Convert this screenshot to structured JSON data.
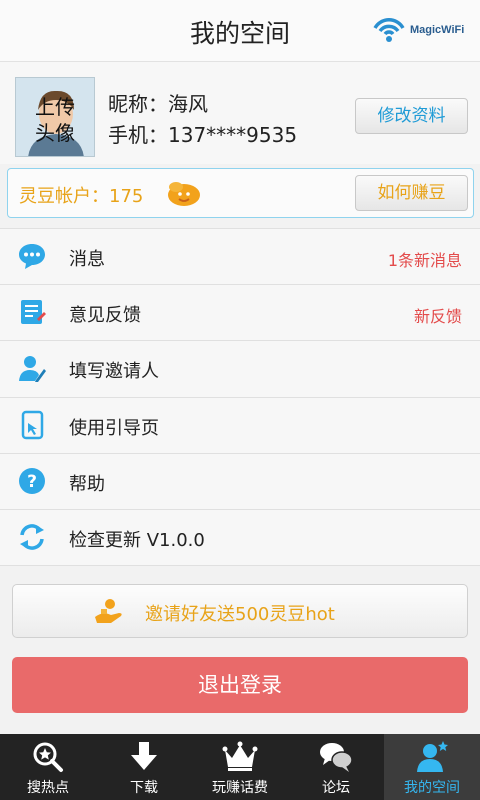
{
  "header": {
    "title": "我的空间",
    "brand_text": "MagicWiFi"
  },
  "profile": {
    "avatar_text_line1": "上传",
    "avatar_text_line2": "头像",
    "nickname": "昵称：海风",
    "phone": "手机：137****9535",
    "edit_button": "修改资料"
  },
  "beans": {
    "label": "灵豆帐户：175",
    "earn_button": "如何赚豆"
  },
  "menu": [
    {
      "icon": "message-bubble-icon",
      "label": "消息",
      "status": "1条新消息"
    },
    {
      "icon": "feedback-note-icon",
      "label": "意见反馈",
      "status": "新反馈"
    },
    {
      "icon": "inviter-person-icon",
      "label": "填写邀请人",
      "status": ""
    },
    {
      "icon": "guide-page-icon",
      "label": "使用引导页",
      "status": ""
    },
    {
      "icon": "help-question-icon",
      "label": "帮助",
      "status": ""
    },
    {
      "icon": "refresh-update-icon",
      "label": "检查更新 V1.0.0",
      "status": ""
    }
  ],
  "invite": {
    "label": "邀请好友送500灵豆hot"
  },
  "logout": {
    "label": "退出登录"
  },
  "tabs": [
    {
      "icon": "search-hotspot-icon",
      "label": "搜热点"
    },
    {
      "icon": "download-arrow-icon",
      "label": "下载"
    },
    {
      "icon": "crown-icon",
      "label": "玩赚话费"
    },
    {
      "icon": "forum-bubbles-icon",
      "label": "论坛"
    },
    {
      "icon": "my-space-person-icon",
      "label": "我的空间"
    }
  ],
  "colors": {
    "accent_blue": "#1f9bd6",
    "bean_orange": "#e8a319",
    "status_red": "#e34b4b",
    "logout_red": "#e96a6a",
    "tabbar_bg": "#232323",
    "tab_active": "#35b7f0"
  }
}
